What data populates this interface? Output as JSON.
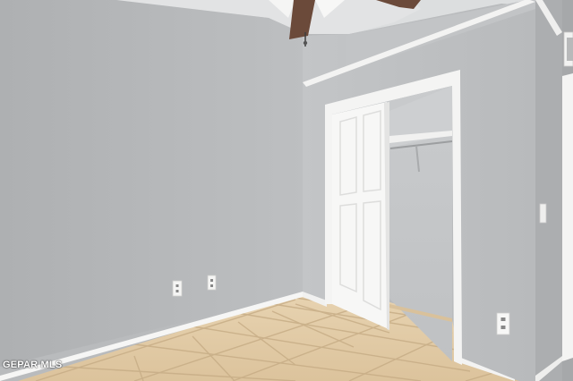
{
  "photo": {
    "subject": "empty-bedroom-with-closet",
    "watermark": "GEPAR MLS"
  },
  "colors": {
    "wall_left": "#b4b6b8",
    "wall_back": "#bdbfc1",
    "wall_right": "#a7a9ab",
    "ceiling": "#dadcdd",
    "trim": "#f4f4f3",
    "floor_tile": "#e3cda8",
    "grout": "#c9b08a",
    "closet_interior": "#c5c7c9",
    "fan_blade": "#6b4a3a"
  }
}
